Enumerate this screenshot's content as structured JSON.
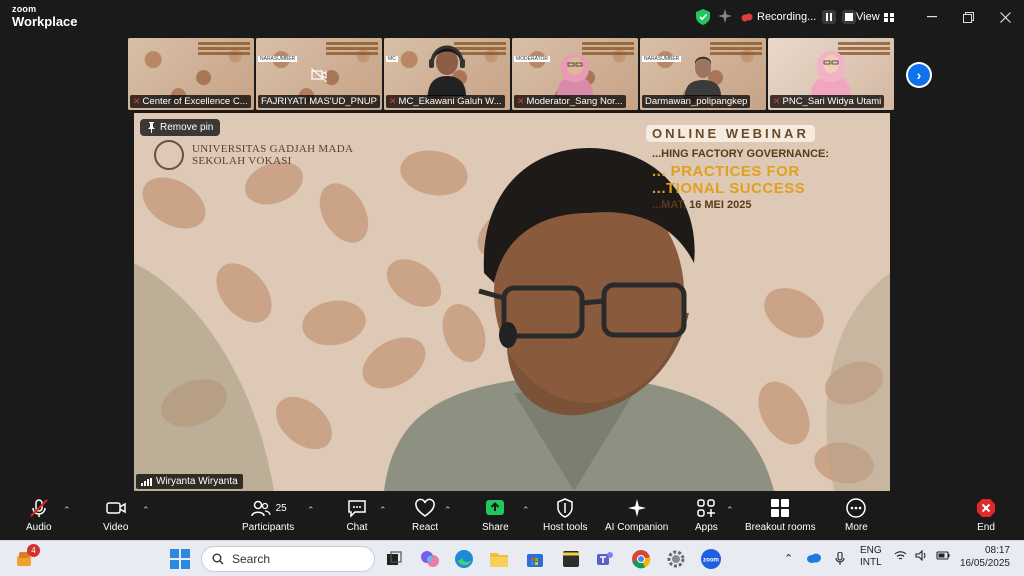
{
  "app": {
    "brand_line1": "zoom",
    "brand_line2": "Workplace",
    "recording_label": "Recording...",
    "view_label": "View"
  },
  "gallery": {
    "tiles": [
      {
        "name": "Center of Excellence C...",
        "muted": true,
        "tag": ""
      },
      {
        "name": "FAJRIYATI MAS'UD_PNUP",
        "muted": false,
        "tag": "NARASUMBER"
      },
      {
        "name": "MC_Ekawani Galuh W...",
        "muted": true,
        "tag": "MC"
      },
      {
        "name": "Moderator_Sang Nor...",
        "muted": true,
        "tag": "MODERATOR"
      },
      {
        "name": "Darmawan_polipangkep",
        "muted": false,
        "tag": "NARASUMBER"
      },
      {
        "name": "PNC_Sari Widya Utami",
        "muted": true,
        "tag": ""
      }
    ]
  },
  "main_video": {
    "pin_label": "Remove pin",
    "speaker_name": "Wiryanta Wiryanta",
    "org_line1": "UNIVERSITAS GADJAH MADA",
    "org_line2": "SEKOLAH VOKASI",
    "webinar_title": "ONLINE WEBINAR",
    "webinar_line2": "...HING FACTORY GOVERNANCE:",
    "webinar_line3": "... PRACTICES FOR",
    "webinar_line4": "...TIONAL SUCCESS",
    "webinar_date": "...MAT, 16 MEI 2025"
  },
  "toolbar": {
    "audio": "Audio",
    "video": "Video",
    "participants": "Participants",
    "participants_count": "25",
    "chat": "Chat",
    "react": "React",
    "share": "Share",
    "host_tools": "Host tools",
    "ai_companion": "AI Companion",
    "apps": "Apps",
    "breakout_rooms": "Breakout rooms",
    "more": "More",
    "end": "End"
  },
  "taskbar": {
    "search_placeholder": "Search",
    "notification_badge": "4",
    "lang_line1": "ENG",
    "lang_line2": "INTL",
    "time": "08:17",
    "date": "16/05/2025"
  },
  "colors": {
    "accent_blue": "#0e72ed",
    "share_green": "#23c55e",
    "end_red": "#e02828",
    "muted_red": "#e23b3b"
  }
}
